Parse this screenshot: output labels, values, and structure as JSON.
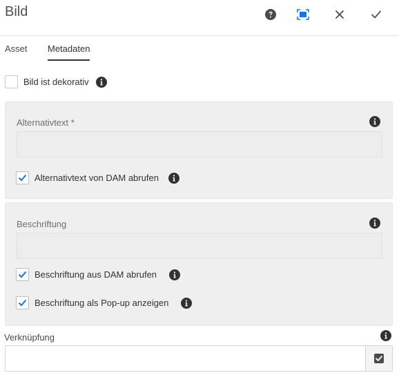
{
  "dialog": {
    "title": "Bild",
    "actions": [
      {
        "name": "help",
        "icon": "help-icon"
      },
      {
        "name": "fullscreen",
        "icon": "fullscreen-icon"
      },
      {
        "name": "close",
        "icon": "close-icon"
      },
      {
        "name": "done",
        "icon": "checkmark-icon"
      }
    ]
  },
  "tabs": [
    {
      "label": "Asset",
      "active": false
    },
    {
      "label": "Metadaten",
      "active": true
    }
  ],
  "decorative": {
    "label": "Bild ist dekorativ",
    "checked": false
  },
  "alt_panel": {
    "label": "Alternativtext *",
    "value": "",
    "checkbox": {
      "label": "Alternativtext von DAM abrufen",
      "checked": true
    }
  },
  "caption_panel": {
    "label": "Beschriftung",
    "value": "",
    "checkboxes": [
      {
        "label": "Beschriftung aus DAM abrufen",
        "checked": true
      },
      {
        "label": "Beschriftung als Pop-up anzeigen",
        "checked": true
      }
    ]
  },
  "link": {
    "label": "Verknüpfung",
    "value": "",
    "picker_icon": "path-picker-icon"
  },
  "colors": {
    "accent": "#1473e6",
    "icon_dark": "#323232",
    "panel_bg": "#efefef"
  }
}
